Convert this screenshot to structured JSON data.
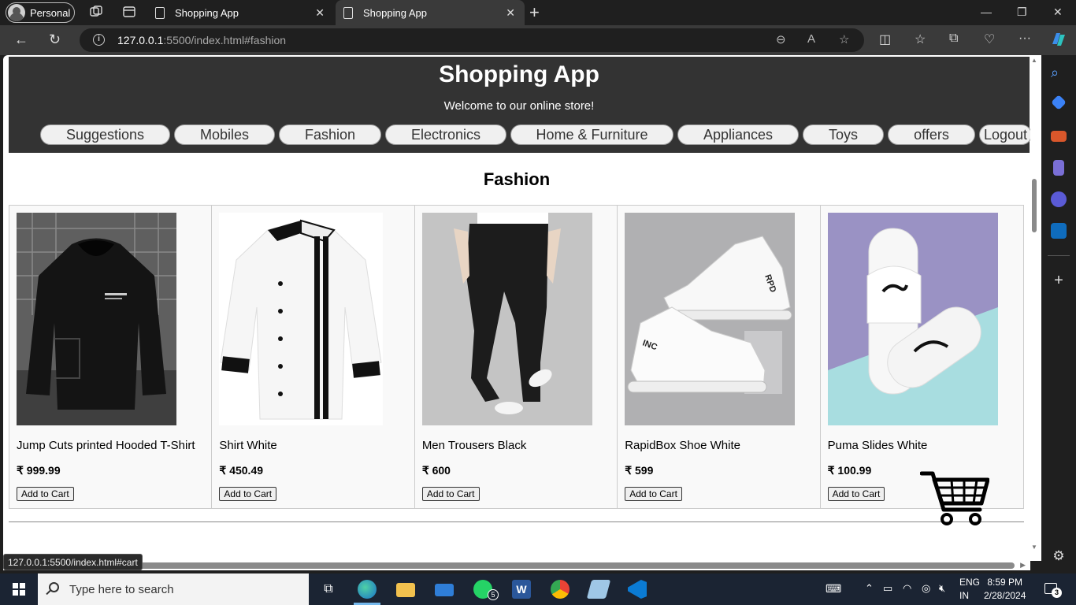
{
  "browser": {
    "profile_label": "Personal",
    "tabs": [
      {
        "title": "Shopping App",
        "active": false
      },
      {
        "title": "Shopping App",
        "active": true
      }
    ],
    "url_host": "127.0.0.1",
    "url_rest": ":5500/index.html#fashion",
    "status_url": "127.0.0.1:5500/index.html#cart"
  },
  "site": {
    "title": "Shopping App",
    "subtitle": "Welcome to our online store!",
    "nav": [
      "Suggestions",
      "Mobiles",
      "Fashion",
      "Electronics",
      "Home & Furniture",
      "Appliances",
      "Toys",
      "offers"
    ],
    "logout_label": "Logout"
  },
  "section": {
    "title": "Fashion",
    "products": [
      {
        "name": "Jump Cuts printed Hooded T-Shirt",
        "price": "₹ 999.99",
        "button": "Add to Cart"
      },
      {
        "name": "Shirt White",
        "price": "₹ 450.49",
        "button": "Add to Cart"
      },
      {
        "name": "Men Trousers Black",
        "price": "₹ 600",
        "button": "Add to Cart"
      },
      {
        "name": "RapidBox Shoe White",
        "price": "₹ 599",
        "button": "Add to Cart"
      },
      {
        "name": "Puma Slides White",
        "price": "₹ 100.99",
        "button": "Add to Cart"
      }
    ]
  },
  "taskbar": {
    "search_placeholder": "Type here to search",
    "whatsapp_badge": "5",
    "lang_line1": "ENG",
    "lang_line2": "IN",
    "time": "8:59 PM",
    "date": "2/28/2024",
    "notification_count": "3"
  },
  "colors": {
    "header_bg": "#333333",
    "nav_pill_bg": "#f0f0f0",
    "taskbar_bg": "#1b2433",
    "chrome_bg": "#1f1f1f",
    "toolbar_bg": "#3a3a3a"
  }
}
